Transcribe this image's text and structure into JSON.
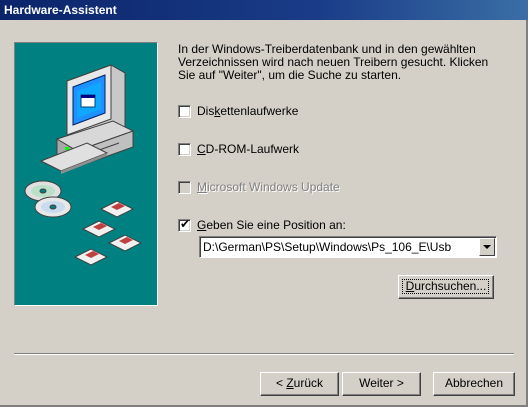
{
  "window": {
    "title": "Hardware-Assistent"
  },
  "description": "In der Windows-Treiberdatenbank und in den gewählten Verzeichnissen wird nach neuen Treibern gesucht. Klicken Sie auf \"Weiter\", um die Suche zu starten.",
  "options": {
    "floppy": {
      "label_pre": "Dis",
      "label_key": "k",
      "label_post": "ettenlaufwerke",
      "checked": false,
      "enabled": true
    },
    "cdrom": {
      "label_pre": "",
      "label_key": "C",
      "label_post": "D-ROM-Laufwerk",
      "checked": false,
      "enabled": true
    },
    "windows_update": {
      "label_pre": "",
      "label_key": "M",
      "label_post": "icrosoft Windows Update",
      "checked": false,
      "enabled": false
    },
    "location": {
      "label_pre": "",
      "label_key": "G",
      "label_post": "eben Sie eine Position an:",
      "checked": true,
      "enabled": true,
      "tick": "✔"
    }
  },
  "location_path": "D:\\German\\PS\\Setup\\Windows\\Ps_106_E\\Usb",
  "buttons": {
    "browse": {
      "pre": "",
      "key": "D",
      "post": "urchsuchen..."
    },
    "back": {
      "pre": "< ",
      "key": "Z",
      "post": "urück"
    },
    "next": "Weiter >",
    "cancel": "Abbrechen"
  },
  "icons": [
    "computer-icon",
    "cd-disc-icon",
    "floppy-disk-icon"
  ],
  "colors": {
    "title_bar": "#0a246a",
    "dialog_bg": "#d4d0c8",
    "illustration_bg": "#008080"
  }
}
